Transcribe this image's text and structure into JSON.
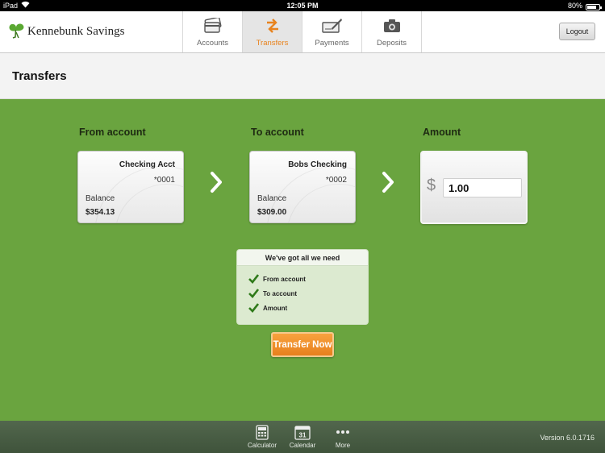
{
  "status_bar": {
    "device": "iPad",
    "time": "12:05 PM",
    "battery_text": "80%",
    "battery_level": 0.8
  },
  "header": {
    "brand": "Kennebunk Savings",
    "tabs": [
      {
        "label": "Accounts",
        "icon": "cards-icon"
      },
      {
        "label": "Transfers",
        "icon": "transfer-arrows-icon",
        "active": true
      },
      {
        "label": "Payments",
        "icon": "check-pen-icon"
      },
      {
        "label": "Deposits",
        "icon": "camera-icon"
      }
    ],
    "logout_label": "Logout",
    "accent_color": "#e8831e"
  },
  "page": {
    "title": "Transfers"
  },
  "transfer": {
    "from_label": "From account",
    "to_label": "To account",
    "amount_label": "Amount",
    "from_account": {
      "name": "Checking Acct",
      "number": "*0001",
      "balance_label": "Balance",
      "balance": "$354.13"
    },
    "to_account": {
      "name": "Bobs Checking",
      "number": "*0002",
      "balance_label": "Balance",
      "balance": "$309.00"
    },
    "currency_symbol": "$",
    "amount_value": "1.00",
    "checklist_title": "We've got all we need",
    "checklist_items": [
      "From account",
      "To account",
      "Amount"
    ],
    "transfer_button": "Transfer Now",
    "background_color": "#6aa43f"
  },
  "bottom_bar": {
    "items": [
      {
        "label": "Calculator",
        "icon": "calculator-icon"
      },
      {
        "label": "Calendar",
        "icon": "calendar-icon",
        "badge": "31"
      },
      {
        "label": "More",
        "icon": "more-dots-icon"
      }
    ],
    "version": "Version 6.0.1716"
  }
}
